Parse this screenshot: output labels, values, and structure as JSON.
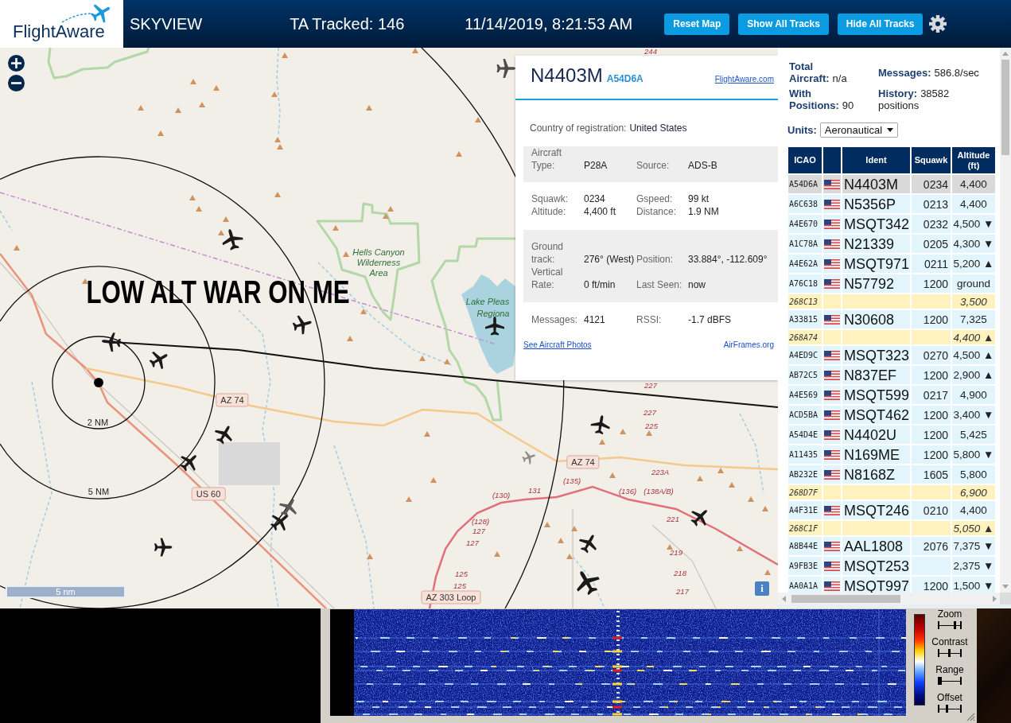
{
  "header": {
    "logo": "FlightAware",
    "title": "SKYVIEW",
    "tracked": "TA Tracked: 146",
    "datetime": "11/14/2019, 8:21:53 AM",
    "buttons": [
      "Reset Map",
      "Show All Tracks",
      "Hide All Tracks"
    ]
  },
  "map": {
    "labels": [
      {
        "kind": "route",
        "text": "244"
      },
      {
        "kind": "overlay",
        "text": "LOW ALT WAR ON ME"
      },
      {
        "kind": "park",
        "text": "Hells Canyon Wilderness Area"
      },
      {
        "kind": "park",
        "text": "Lake Pleas"
      },
      {
        "kind": "park",
        "text": "Regiona"
      },
      {
        "kind": "shield",
        "text": "AZ 74"
      },
      {
        "kind": "ring",
        "text": "2 NM"
      },
      {
        "kind": "ring",
        "text": "5 NM"
      },
      {
        "kind": "shield",
        "text": "US 60"
      },
      {
        "kind": "shield",
        "text": "AZ 74"
      },
      {
        "kind": "route",
        "text": "227"
      },
      {
        "kind": "route",
        "text": "227"
      },
      {
        "kind": "route",
        "text": "225"
      },
      {
        "kind": "route",
        "text": "223A"
      },
      {
        "kind": "route",
        "text": "(130)"
      },
      {
        "kind": "route",
        "text": "131"
      },
      {
        "kind": "route",
        "text": "(135)"
      },
      {
        "kind": "route",
        "text": "(136)"
      },
      {
        "kind": "route",
        "text": "(138A/B)"
      },
      {
        "kind": "route",
        "text": "221"
      },
      {
        "kind": "route",
        "text": "(128)"
      },
      {
        "kind": "route",
        "text": "127"
      },
      {
        "kind": "route",
        "text": "127"
      },
      {
        "kind": "route",
        "text": "219"
      },
      {
        "kind": "route",
        "text": "125"
      },
      {
        "kind": "route",
        "text": "218"
      },
      {
        "kind": "route",
        "text": "125"
      },
      {
        "kind": "route",
        "text": "217"
      },
      {
        "kind": "shield",
        "text": "AZ 303 Loop"
      }
    ],
    "aircraft": [
      {
        "color": "#4d4d4d"
      },
      {
        "color": "#1a1a1a"
      },
      {
        "color": "#1a1a1a"
      },
      {
        "color": "#1a1a1a"
      },
      {
        "color": "#1a1a1a"
      },
      {
        "color": "#1a1a1a"
      },
      {
        "color": "#1a1a1a"
      },
      {
        "color": "#1a1a1a"
      },
      {
        "color": "#595959"
      },
      {
        "color": "#1a1a1a"
      },
      {
        "color": "#1a1a1a"
      },
      {
        "color": "#1a1a1a"
      },
      {
        "color": "#8c8c8c"
      },
      {
        "color": "#1a1a1a"
      },
      {
        "color": "#1a1a1a"
      },
      {
        "color": "#1a1a1a"
      }
    ],
    "scale_bar": "5 nm",
    "info_button": "i"
  },
  "popup": {
    "callsign": "N4403M",
    "icao": "A54D6A",
    "link": "FlightAware.com",
    "country_label": "Country of registration:",
    "country": "United States",
    "sections": [
      {
        "shaded": true,
        "fields": [
          {
            "label": "Aircraft Type:",
            "value": "P28A"
          },
          {
            "label": "Source:",
            "value": "ADS-B"
          }
        ]
      },
      {
        "shaded": false,
        "fields": [
          {
            "label": "Squawk:",
            "value": "0234"
          },
          {
            "label": "Gspeed:",
            "value": "99 kt"
          },
          {
            "label": "Altitude:",
            "value": "4,400 ft"
          },
          {
            "label": "Distance:",
            "value": "1.9 NM"
          }
        ]
      },
      {
        "shaded": true,
        "fields": [
          {
            "label": "Ground track:",
            "value": "276° (West)"
          },
          {
            "label": "Position:",
            "value": "33.884°, -112.609°"
          },
          {
            "label": "Vertical Rate:",
            "value": "0 ft/min"
          },
          {
            "label": "Last Seen:",
            "value": "now"
          }
        ]
      },
      {
        "shaded": false,
        "fields": [
          {
            "label": "Messages:",
            "value": "4121"
          },
          {
            "label": "RSSI:",
            "value": "-1.7 dBFS"
          }
        ]
      }
    ],
    "links": [
      "See Aircraft Photos",
      "AirFrames.org"
    ]
  },
  "side_panel": {
    "stats": [
      {
        "label": "Total Aircraft:",
        "value": "n/a"
      },
      {
        "label": "Messages:",
        "value": "586.8/sec"
      },
      {
        "label": "With Positions:",
        "value": "90"
      },
      {
        "label": "History:",
        "value": "38582 positions"
      }
    ],
    "units": {
      "label": "Units:",
      "value": "Aeronautical"
    },
    "table": {
      "columns": [
        "ICAO",
        "Ident",
        "Squawk",
        "Altitude (ft)"
      ],
      "rows": [
        {
          "kind": "icao",
          "icao": "A54D6A",
          "ident": "N4403M",
          "squawk": "0234",
          "altitude": "4,400",
          "selected": true
        },
        {
          "kind": "icao",
          "icao": "A6C638",
          "ident": "N5356P",
          "squawk": "0213",
          "altitude": "4,400",
          "selected": false
        },
        {
          "kind": "icao",
          "icao": "A4E670",
          "ident": "MSQT342",
          "squawk": "0232",
          "altitude": "4,500 ▼",
          "selected": false
        },
        {
          "kind": "icao",
          "icao": "A1C78A",
          "ident": "N21339",
          "squawk": "0205",
          "altitude": "4,300 ▼",
          "selected": false
        },
        {
          "kind": "icao",
          "icao": "A4E62A",
          "ident": "MSQT971",
          "squawk": "0211",
          "altitude": "5,200 ▲",
          "selected": false
        },
        {
          "kind": "icao",
          "icao": "A76C18",
          "ident": "N57792",
          "squawk": "1200",
          "altitude": "ground",
          "selected": false
        },
        {
          "kind": "non_icao",
          "icao": "268C13",
          "altitude": "3,500",
          "selected": false
        },
        {
          "kind": "icao",
          "icao": "A33815",
          "ident": "N30608",
          "squawk": "1200",
          "altitude": "7,325",
          "selected": false
        },
        {
          "kind": "non_icao",
          "icao": "268A74",
          "altitude": "4,400 ▲",
          "selected": false
        },
        {
          "kind": "icao",
          "icao": "A4ED9C",
          "ident": "MSQT323",
          "squawk": "0270",
          "altitude": "4,500 ▲",
          "selected": false
        },
        {
          "kind": "icao",
          "icao": "AB72C5",
          "ident": "N837EF",
          "squawk": "1200",
          "altitude": "2,900 ▲",
          "selected": false
        },
        {
          "kind": "icao",
          "icao": "A4E569",
          "ident": "MSQT599",
          "squawk": "0217",
          "altitude": "4,900",
          "selected": false
        },
        {
          "kind": "icao",
          "icao": "ACD5BA",
          "ident": "MSQT462",
          "squawk": "1200",
          "altitude": "3,400 ▼",
          "selected": false
        },
        {
          "kind": "icao",
          "icao": "A54D4E",
          "ident": "N4402U",
          "squawk": "1200",
          "altitude": "5,425",
          "selected": false
        },
        {
          "kind": "icao",
          "icao": "A11435",
          "ident": "N169ME",
          "squawk": "1200",
          "altitude": "5,800 ▼",
          "selected": false
        },
        {
          "kind": "icao",
          "icao": "AB232E",
          "ident": "N8168Z",
          "squawk": "1605",
          "altitude": "5,800",
          "selected": false
        },
        {
          "kind": "non_icao",
          "icao": "268D7F",
          "altitude": "6,900",
          "selected": false
        },
        {
          "kind": "icao",
          "icao": "A4F31E",
          "ident": "MSQT246",
          "squawk": "0210",
          "altitude": "4,400",
          "selected": false
        },
        {
          "kind": "non_icao",
          "icao": "268C1F",
          "altitude": "5,050 ▲",
          "selected": false
        },
        {
          "kind": "icao",
          "icao": "A8B44E",
          "ident": "AAL1808",
          "squawk": "2076",
          "altitude": "7,375 ▼",
          "selected": false
        },
        {
          "kind": "icao",
          "icao": "A9FB3E",
          "ident": "MSQT253",
          "altitude": "2,375 ▼",
          "selected": false
        },
        {
          "kind": "icao",
          "icao": "AA0A1A",
          "ident": "MSQT997",
          "squawk": "1200",
          "altitude": "1,500 ▼",
          "selected": false
        }
      ]
    }
  },
  "waterfall": {
    "controls": [
      {
        "label": "Zoom",
        "level": 0.7
      },
      {
        "label": "Contrast",
        "level": 0.5
      },
      {
        "label": "Range",
        "level": 0.1
      },
      {
        "label": "Offset",
        "level": 0.4
      }
    ]
  }
}
